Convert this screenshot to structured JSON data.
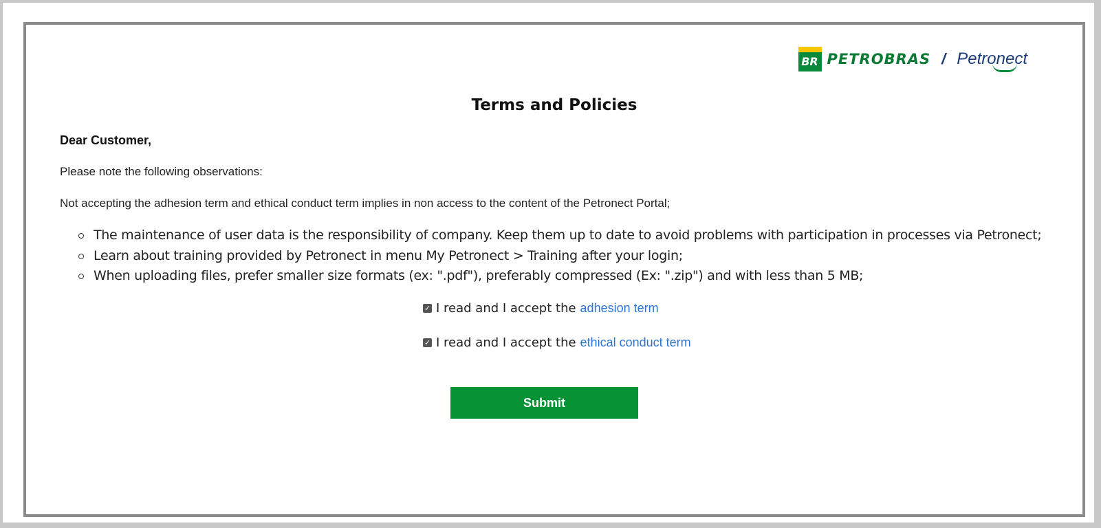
{
  "logo": {
    "br_badge_text": "BR",
    "brand_primary": "PETROBRAS",
    "separator": "/",
    "brand_secondary": "Petronect"
  },
  "page": {
    "title": "Terms and Policies",
    "greeting": "Dear Customer,",
    "intro": "Please note the following observations:",
    "warning": "Not accepting the adhesion term and ethical conduct term implies in non access to the content of the Petronect Portal;"
  },
  "observations": [
    "The maintenance of user data is the responsibility of company. Keep them up to date to avoid problems with participation in processes via Petronect;",
    "Learn about training provided by Petronect in menu My Petronect > Training after your login;",
    "When uploading files, prefer smaller size formats (ex: \".pdf\"), preferably compressed (Ex: \".zip\") and with less than 5 MB;"
  ],
  "acceptance": {
    "adhesion": {
      "checked": true,
      "prefix": "I read and I accept the",
      "link": "adhesion term"
    },
    "ethical": {
      "checked": true,
      "prefix": "I read and I accept the",
      "link": "ethical conduct term"
    }
  },
  "submit_label": "Submit",
  "colors": {
    "brand_green": "#079236",
    "brand_yellow": "#f7c600",
    "link_blue": "#2a74d4",
    "petronect_navy": "#1b3a7a"
  }
}
